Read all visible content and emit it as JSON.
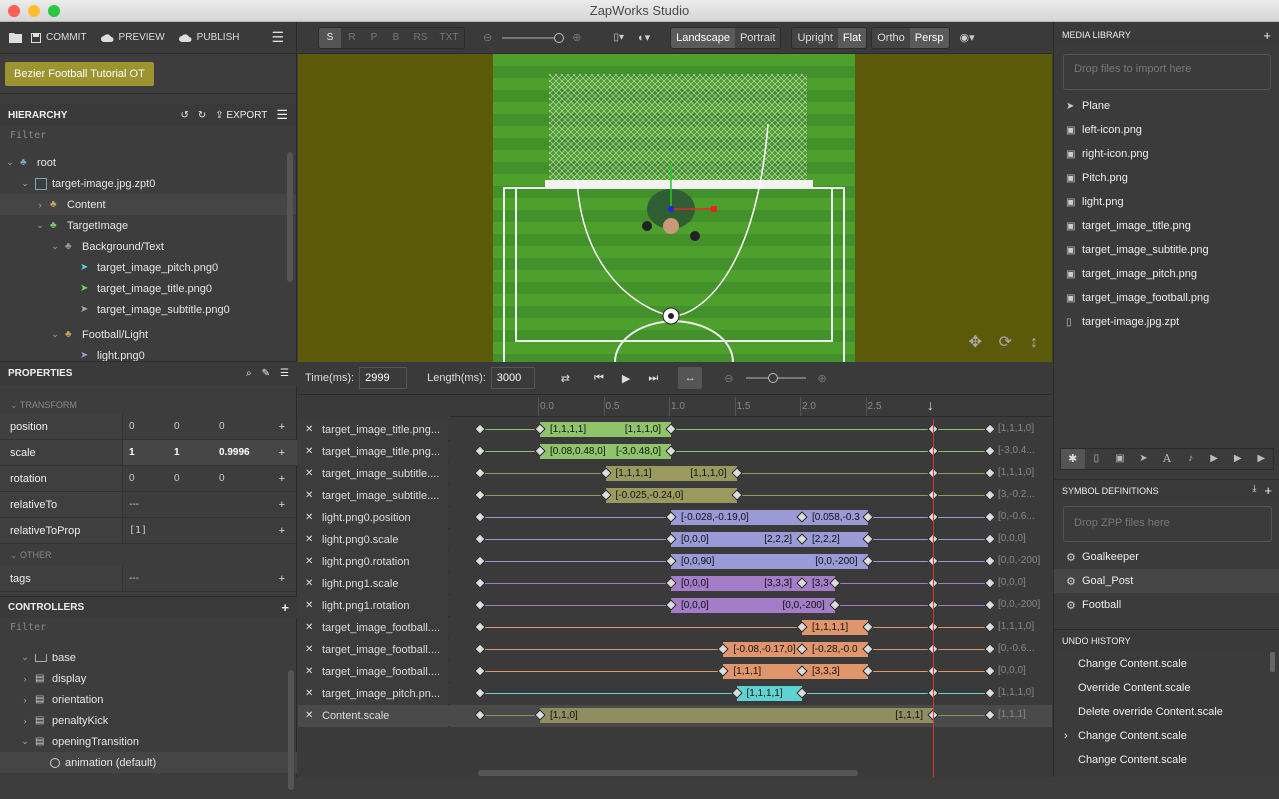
{
  "window": {
    "title": "ZapWorks Studio"
  },
  "left_toolbar": {
    "commit": "COMMIT",
    "preview": "PREVIEW",
    "publish": "PUBLISH"
  },
  "project_button": "Bezier Football Tutorial OT",
  "hierarchy": {
    "title": "HIERARCHY",
    "export": "EXPORT",
    "filter": "Filter",
    "items": [
      {
        "label": "root"
      },
      {
        "label": "target-image.jpg.zpt0"
      },
      {
        "label": "Content"
      },
      {
        "label": "TargetImage"
      },
      {
        "label": "Background/Text"
      },
      {
        "label": "target_image_pitch.png0"
      },
      {
        "label": "target_image_title.png0"
      },
      {
        "label": "target_image_subtitle.png0"
      },
      {
        "label": "Football/Light"
      },
      {
        "label": "light.png0"
      }
    ]
  },
  "properties": {
    "title": "PROPERTIES",
    "transform_label": "TRANSFORM",
    "other_label": "OTHER",
    "rows": [
      {
        "name": "position",
        "v1": "0",
        "v2": "0",
        "v3": "0"
      },
      {
        "name": "scale",
        "v1": "1",
        "v2": "1",
        "v3": "0.9996"
      },
      {
        "name": "rotation",
        "v1": "0",
        "v2": "0",
        "v3": "0"
      },
      {
        "name": "relativeTo",
        "v1": "---"
      },
      {
        "name": "relativeToProp",
        "v1": "[1]"
      }
    ],
    "tags": {
      "name": "tags",
      "v1": "---"
    }
  },
  "controllers": {
    "title": "CONTROLLERS",
    "filter": "Filter",
    "items": [
      {
        "label": "base"
      },
      {
        "label": "display"
      },
      {
        "label": "orientation"
      },
      {
        "label": "penaltyKick"
      },
      {
        "label": "openingTransition"
      },
      {
        "label": "animation (default)"
      }
    ]
  },
  "viewport_toolbar": {
    "modes": [
      "S",
      "R",
      "P",
      "B",
      "RS",
      "TXT"
    ],
    "orientation": [
      "Landscape",
      "Portrait"
    ],
    "tracking": [
      "Upright",
      "Flat"
    ],
    "projection": [
      "Ortho",
      "Persp"
    ]
  },
  "timeline": {
    "time_label": "Time(ms):",
    "time_value": "2999",
    "length_label": "Length(ms):",
    "length_value": "3000",
    "ruler": [
      "0.0",
      "0.5",
      "1.0",
      "1.5",
      "2.0",
      "2.5"
    ],
    "tracks": [
      {
        "label": "target_image_title.png...",
        "bars": [
          {
            "start": 0.0,
            "end": 1.0,
            "color": "#8fc46a",
            "t1": "[1,1,1,1]",
            "t2": "[1,1,1,0]"
          }
        ],
        "end_value": "[1,1,1,0]"
      },
      {
        "label": "target_image_title.png...",
        "bars": [
          {
            "start": 0.0,
            "end": 1.0,
            "color": "#8fc46a",
            "t1": "[0.08,0.48,0]",
            "t2": "[-3,0.48,0]"
          }
        ],
        "end_value": "[-3,0.4..."
      },
      {
        "label": "target_image_subtitle....",
        "bars": [
          {
            "start": 0.5,
            "end": 1.5,
            "color": "#9b9a5e",
            "t1": "[1,1,1,1]",
            "t2": "[1,1,1,0]"
          }
        ],
        "end_value": "[1,1,1,0]"
      },
      {
        "label": "target_image_subtitle....",
        "bars": [
          {
            "start": 0.5,
            "end": 1.5,
            "color": "#9b9a5e",
            "t1": "[-0.025,-0.24,0]",
            "t2": ""
          }
        ],
        "end_value": "[3,-0.2..."
      },
      {
        "label": "light.png0.position",
        "bars": [
          {
            "start": 1.0,
            "end": 2.0,
            "color": "#9a9ad6",
            "t1": "[-0.028,-0.19,0]",
            "t2": ""
          },
          {
            "start": 2.0,
            "end": 2.5,
            "color": "#9a9ad6",
            "t1": "[0.058,-0.3",
            "t2": ""
          }
        ],
        "end_value": "[0,-0.6..."
      },
      {
        "label": "light.png0.scale",
        "bars": [
          {
            "start": 1.0,
            "end": 2.0,
            "color": "#9a9ad6",
            "t1": "[0,0,0]",
            "t2": "[2,2,2]"
          },
          {
            "start": 2.0,
            "end": 2.5,
            "color": "#9a9ad6",
            "t1": "[2,2,2]",
            "t2": ""
          }
        ],
        "end_value": "[0,0,0]"
      },
      {
        "label": "light.png0.rotation",
        "bars": [
          {
            "start": 1.0,
            "end": 2.5,
            "color": "#9a9ad6",
            "t1": "[0,0,90]",
            "t2": "[0,0,-200]"
          }
        ],
        "end_value": "[0,0,-200]"
      },
      {
        "label": "light.png1.scale",
        "bars": [
          {
            "start": 1.0,
            "end": 2.0,
            "color": "#a47cc8",
            "t1": "[0,0,0]",
            "t2": "[3,3,3]"
          },
          {
            "start": 2.0,
            "end": 2.25,
            "color": "#a47cc8",
            "t1": "[3,3",
            "t2": ""
          }
        ],
        "end_value": "[0,0,0]"
      },
      {
        "label": "light.png1.rotation",
        "bars": [
          {
            "start": 1.0,
            "end": 2.25,
            "color": "#a47cc8",
            "t1": "[0,0,0]",
            "t2": "[0,0,-200]"
          }
        ],
        "end_value": "[0,0,-200]"
      },
      {
        "label": "target_image_football....",
        "bars": [
          {
            "start": 2.0,
            "end": 2.5,
            "color": "#e0956a",
            "t1": "[1,1,1,1]",
            "t2": ""
          }
        ],
        "end_value": "[1,1,1,0]"
      },
      {
        "label": "target_image_football....",
        "bars": [
          {
            "start": 1.4,
            "end": 2.0,
            "color": "#e0956a",
            "t1": "[-0.08,-0.17,0]",
            "t2": ""
          },
          {
            "start": 2.0,
            "end": 2.5,
            "color": "#e0956a",
            "t1": "[-0.28,-0.0",
            "t2": ""
          }
        ],
        "end_value": "[0,-0.6..."
      },
      {
        "label": "target_image_football....",
        "bars": [
          {
            "start": 1.4,
            "end": 2.0,
            "color": "#e0956a",
            "t1": "[1,1,1]",
            "t2": ""
          },
          {
            "start": 2.0,
            "end": 2.5,
            "color": "#e0956a",
            "t1": "[3,3,3]",
            "t2": ""
          }
        ],
        "end_value": "[0,0,0]"
      },
      {
        "label": "target_image_pitch.pn...",
        "bars": [
          {
            "start": 1.5,
            "end": 2.0,
            "color": "#5fd3d3",
            "t1": "[1,1,1,1]",
            "t2": ""
          }
        ],
        "end_value": "[1,1,1,0]"
      },
      {
        "label": "Content.scale",
        "bars": [
          {
            "start": 0.0,
            "end": 3.0,
            "color": "#8e8e60",
            "t1": "[1,1,0]",
            "t2": "[1,1,1]"
          }
        ],
        "end_value": "[1,1,1]"
      }
    ]
  },
  "media_library": {
    "title": "MEDIA LIBRARY",
    "drop_hint": "Drop files to import here",
    "items": [
      "Plane",
      "left-icon.png",
      "right-icon.png",
      "Pitch.png",
      "light.png",
      "target_image_title.png",
      "target_image_subtitle.png",
      "target_image_pitch.png",
      "target_image_football.png",
      "target-image.jpg.zpt"
    ]
  },
  "symbols": {
    "title": "SYMBOL DEFINITIONS",
    "drop_hint": "Drop ZPP files here",
    "items": [
      "Goalkeeper",
      "Goal_Post",
      "Football"
    ]
  },
  "undo": {
    "title": "UNDO HISTORY",
    "items": [
      "Change Content.scale",
      "Override Content.scale",
      "Delete override Content.scale",
      "Change Content.scale",
      "Change Content.scale"
    ]
  }
}
